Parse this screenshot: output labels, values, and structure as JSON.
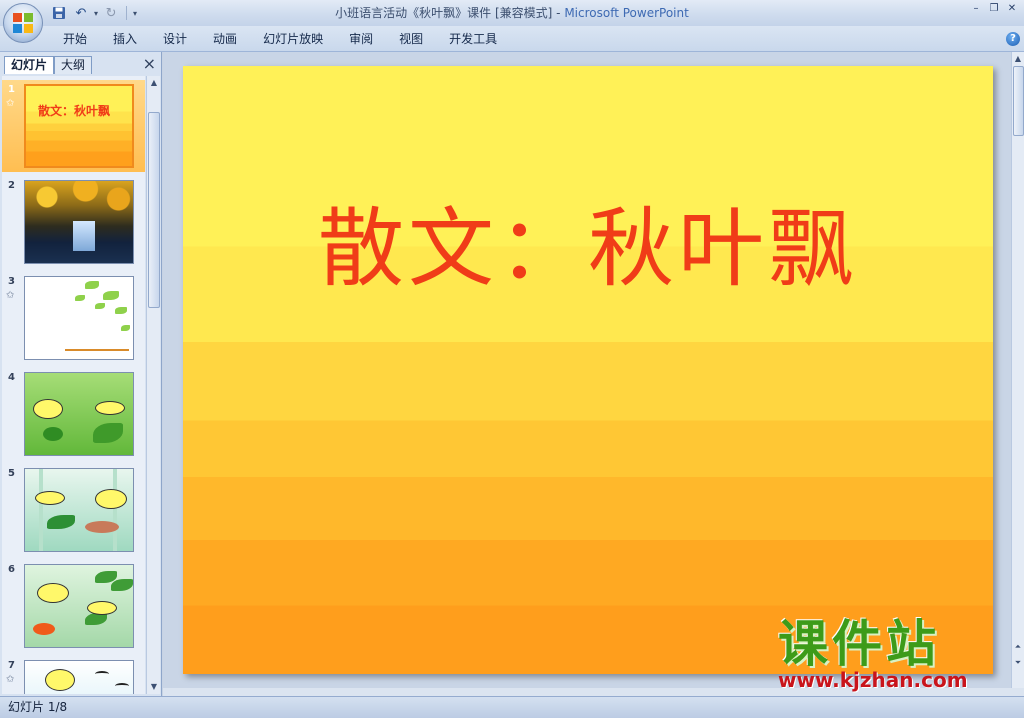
{
  "window": {
    "doc_title": "小班语言活动《秋叶飘》课件 [兼容模式]",
    "separator": " - ",
    "app_name": "Microsoft PowerPoint"
  },
  "ribbon": {
    "tabs": [
      "开始",
      "插入",
      "设计",
      "动画",
      "幻灯片放映",
      "审阅",
      "视图",
      "开发工具"
    ],
    "help": "?"
  },
  "left_pane": {
    "tab_slides": "幻灯片",
    "tab_outline": "大纲",
    "close": "×",
    "selected_slide": 1,
    "slides": [
      {
        "num": "1",
        "text": "散文：秋叶飘"
      },
      {
        "num": "2"
      },
      {
        "num": "3"
      },
      {
        "num": "4"
      },
      {
        "num": "5"
      },
      {
        "num": "6"
      },
      {
        "num": "7"
      }
    ]
  },
  "slide": {
    "title": "散文：秋叶飘"
  },
  "status": {
    "slide_info": "幻灯片 1/8"
  },
  "watermark": {
    "cn": "课件站",
    "url": "www.kjzhan.com"
  },
  "colors": {
    "title_red": "#f03c18",
    "watermark_green": "#3d9b19",
    "watermark_red": "#c9141b",
    "selected_thumb": "#ffbe51"
  }
}
